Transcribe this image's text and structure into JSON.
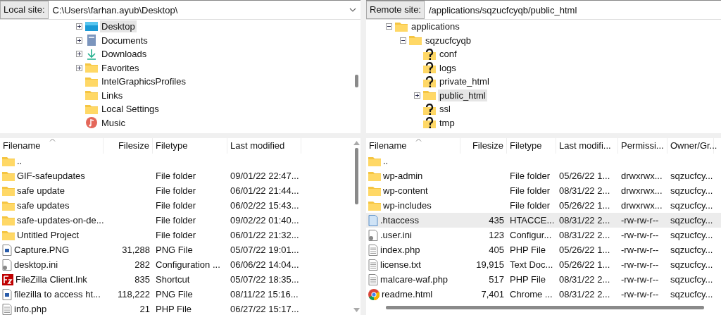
{
  "local": {
    "site_label": "Local site:",
    "path": "C:\\Users\\farhan.ayub\\Desktop\\",
    "tree": [
      {
        "label": "Desktop",
        "kind": "desktop",
        "expanded": false,
        "expandable": true,
        "selected": true
      },
      {
        "label": "Documents",
        "kind": "documents",
        "expanded": false,
        "expandable": true,
        "selected": false
      },
      {
        "label": "Downloads",
        "kind": "downloads",
        "expanded": false,
        "expandable": true,
        "selected": false
      },
      {
        "label": "Favorites",
        "kind": "folder",
        "expanded": false,
        "expandable": true,
        "selected": false
      },
      {
        "label": "IntelGraphicsProfiles",
        "kind": "folder",
        "expandable": false,
        "selected": false
      },
      {
        "label": "Links",
        "kind": "folder",
        "expandable": false,
        "selected": false
      },
      {
        "label": "Local Settings",
        "kind": "folder",
        "expandable": false,
        "selected": false
      },
      {
        "label": "Music",
        "kind": "music",
        "expandable": false,
        "selected": false
      }
    ],
    "columns": [
      "Filename",
      "Filesize",
      "Filetype",
      "Last modified"
    ],
    "rows": [
      {
        "kind": "folder",
        "selected": false,
        "cells": [
          "..",
          "",
          "",
          ""
        ]
      },
      {
        "kind": "folder",
        "selected": false,
        "cells": [
          "GIF-safeupdates",
          "",
          "File folder",
          "09/01/22 22:47..."
        ]
      },
      {
        "kind": "folder",
        "selected": false,
        "cells": [
          "safe update",
          "",
          "File folder",
          "06/01/22 21:44..."
        ]
      },
      {
        "kind": "folder",
        "selected": false,
        "cells": [
          "safe updates",
          "",
          "File folder",
          "06/02/22 15:43..."
        ]
      },
      {
        "kind": "folder",
        "selected": false,
        "cells": [
          "safe-updates-on-de...",
          "",
          "File folder",
          "09/02/22 01:40..."
        ]
      },
      {
        "kind": "folder",
        "selected": false,
        "cells": [
          "Untitled Project",
          "",
          "File folder",
          "06/01/22 21:32..."
        ]
      },
      {
        "kind": "image",
        "selected": false,
        "cells": [
          "Capture.PNG",
          "31,288",
          "PNG File",
          "05/07/22 19:01..."
        ]
      },
      {
        "kind": "config",
        "selected": false,
        "cells": [
          "desktop.ini",
          "282",
          "Configuration ...",
          "06/06/22 14:04..."
        ]
      },
      {
        "kind": "shortcut",
        "selected": false,
        "cells": [
          "FileZilla Client.lnk",
          "835",
          "Shortcut",
          "05/07/22 18:35..."
        ]
      },
      {
        "kind": "image",
        "selected": false,
        "cells": [
          "filezilla to access ht...",
          "118,222",
          "PNG File",
          "08/11/22 15:16..."
        ]
      },
      {
        "kind": "text",
        "selected": false,
        "cells": [
          "info.php",
          "21",
          "PHP File",
          "06/27/22 15:17..."
        ]
      }
    ]
  },
  "remote": {
    "site_label": "Remote site:",
    "path": "/applications/sqzucfcyqb/public_html",
    "tree": [
      {
        "label": "applications",
        "kind": "folder",
        "expanded": true,
        "expandable": true,
        "selected": false,
        "children": [
          {
            "label": "sqzucfcyqb",
            "kind": "folder",
            "expanded": true,
            "expandable": true,
            "selected": false,
            "children": [
              {
                "label": "conf",
                "kind": "unknown",
                "expandable": false,
                "selected": false
              },
              {
                "label": "logs",
                "kind": "unknown",
                "expandable": false,
                "selected": false
              },
              {
                "label": "private_html",
                "kind": "unknown",
                "expandable": false,
                "selected": false
              },
              {
                "label": "public_html",
                "kind": "folder",
                "expanded": false,
                "expandable": true,
                "selected": true
              },
              {
                "label": "ssl",
                "kind": "unknown",
                "expandable": false,
                "selected": false
              },
              {
                "label": "tmp",
                "kind": "unknown",
                "expandable": false,
                "selected": false
              }
            ]
          }
        ]
      }
    ],
    "columns": [
      "Filename",
      "Filesize",
      "Filetype",
      "Last modifi...",
      "Permissi...",
      "Owner/Gr..."
    ],
    "rows": [
      {
        "kind": "folder",
        "selected": false,
        "cells": [
          "..",
          "",
          "",
          "",
          "",
          ""
        ]
      },
      {
        "kind": "folder",
        "selected": false,
        "cells": [
          "wp-admin",
          "",
          "File folder",
          "05/26/22 1...",
          "drwxrwx...",
          "sqzucfcy..."
        ]
      },
      {
        "kind": "folder",
        "selected": false,
        "cells": [
          "wp-content",
          "",
          "File folder",
          "08/31/22 2...",
          "drwxrwx...",
          "sqzucfcy..."
        ]
      },
      {
        "kind": "folder",
        "selected": false,
        "cells": [
          "wp-includes",
          "",
          "File folder",
          "05/26/22 1...",
          "drwxrwx...",
          "sqzucfcy..."
        ]
      },
      {
        "kind": "htaccess",
        "selected": true,
        "cells": [
          ".htaccess",
          "435",
          "HTACCE...",
          "08/31/22 2...",
          "-rw-rw-r--",
          "sqzucfcy..."
        ]
      },
      {
        "kind": "config",
        "selected": false,
        "cells": [
          ".user.ini",
          "123",
          "Configur...",
          "08/31/22 2...",
          "-rw-rw-r--",
          "sqzucfcy..."
        ]
      },
      {
        "kind": "text",
        "selected": false,
        "cells": [
          "index.php",
          "405",
          "PHP File",
          "05/26/22 1...",
          "-rw-rw-r--",
          "sqzucfcy..."
        ]
      },
      {
        "kind": "text",
        "selected": false,
        "cells": [
          "license.txt",
          "19,915",
          "Text Doc...",
          "05/26/22 1...",
          "-rw-rw-r--",
          "sqzucfcy..."
        ]
      },
      {
        "kind": "text",
        "selected": false,
        "cells": [
          "malcare-waf.php",
          "517",
          "PHP File",
          "08/31/22 2...",
          "-rw-rw-r--",
          "sqzucfcy..."
        ]
      },
      {
        "kind": "chrome",
        "selected": false,
        "cells": [
          "readme.html",
          "7,401",
          "Chrome ...",
          "08/31/22 2...",
          "-rw-rw-r--",
          "sqzucfcy..."
        ]
      }
    ]
  }
}
